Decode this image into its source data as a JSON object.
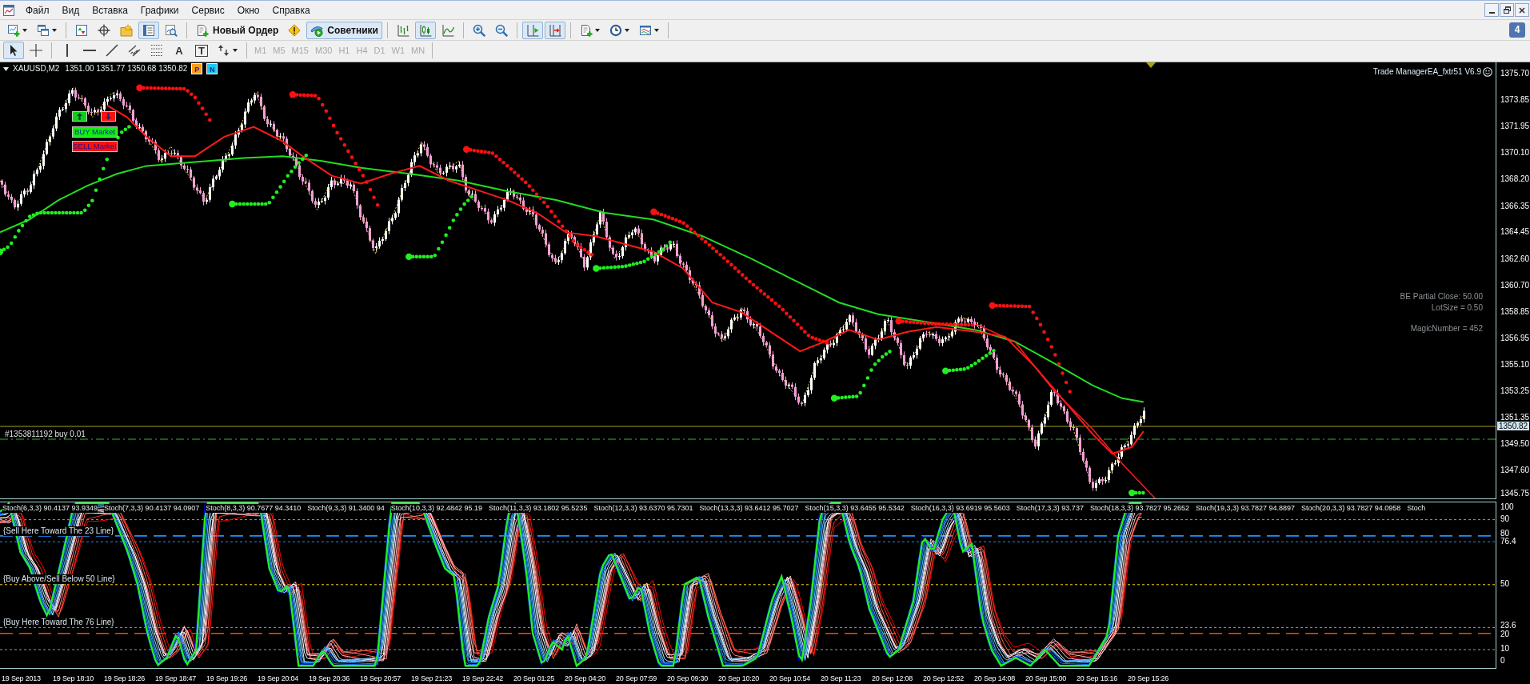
{
  "menu": [
    {
      "label": "Файл"
    },
    {
      "label": "Вид"
    },
    {
      "label": "Вставка"
    },
    {
      "label": "Графики"
    },
    {
      "label": "Сервис"
    },
    {
      "label": "Окно"
    },
    {
      "label": "Справка"
    }
  ],
  "toolbar_1": [
    {
      "kind": "dropdown",
      "pressed": false
    },
    {
      "kind": "dropdown",
      "pressed": false
    },
    {
      "kind": "separator"
    },
    {
      "kind": "icon",
      "pressed": false
    },
    {
      "kind": "icon",
      "pressed": false
    },
    {
      "kind": "icon",
      "pressed": false
    },
    {
      "kind": "icon",
      "pressed": true
    },
    {
      "kind": "icon",
      "pressed": false
    },
    {
      "kind": "separator"
    },
    {
      "kind": "labeled",
      "label": "Новый Ордер",
      "pressed": false
    },
    {
      "kind": "icon",
      "pressed": false
    },
    {
      "kind": "labeled",
      "label": "Советники",
      "pressed": true
    },
    {
      "kind": "separator"
    },
    {
      "kind": "icon",
      "pressed": false
    },
    {
      "kind": "icon",
      "pressed": true
    },
    {
      "kind": "icon",
      "pressed": false
    },
    {
      "kind": "separator"
    },
    {
      "kind": "icon",
      "pressed": false
    },
    {
      "kind": "icon",
      "pressed": false
    },
    {
      "kind": "separator"
    },
    {
      "kind": "icon",
      "pressed": true
    },
    {
      "kind": "icon",
      "pressed": true
    },
    {
      "kind": "separator"
    },
    {
      "kind": "dropdown",
      "pressed": false
    },
    {
      "kind": "dropdown",
      "pressed": false
    },
    {
      "kind": "dropdown",
      "pressed": false
    },
    {
      "kind": "separator"
    }
  ],
  "messages_badge": "4",
  "toolbar_2": [
    {
      "kind": "icon",
      "pressed": true
    },
    {
      "kind": "icon",
      "pressed": false
    },
    {
      "kind": "separator"
    },
    {
      "kind": "icon",
      "pressed": false
    },
    {
      "kind": "icon",
      "pressed": false
    },
    {
      "kind": "icon",
      "pressed": false
    },
    {
      "kind": "icon",
      "pressed": false
    },
    {
      "kind": "icon",
      "pressed": false
    },
    {
      "kind": "glyph",
      "glyph": "A",
      "framed": false,
      "pressed": false
    },
    {
      "kind": "glyph",
      "glyph": "T",
      "framed": true,
      "pressed": false
    },
    {
      "kind": "dropdown",
      "pressed": false
    },
    {
      "kind": "separator"
    },
    {
      "kind": "timeframe",
      "label": "M1",
      "disabled": true
    },
    {
      "kind": "timeframe",
      "label": "M5",
      "disabled": true
    },
    {
      "kind": "timeframe",
      "label": "M15",
      "disabled": true
    },
    {
      "kind": "timeframe",
      "label": "M30",
      "disabled": true
    },
    {
      "kind": "timeframe",
      "label": "H1",
      "disabled": true
    },
    {
      "kind": "timeframe",
      "label": "H4",
      "disabled": true
    },
    {
      "kind": "timeframe",
      "label": "D1",
      "disabled": true
    },
    {
      "kind": "timeframe",
      "label": "W1",
      "disabled": true
    },
    {
      "kind": "timeframe",
      "label": "MN",
      "disabled": true
    },
    {
      "kind": "separator"
    }
  ],
  "chart": {
    "symbol": "XAUUSD,M2",
    "quote": "1351.00 1351.77 1350.68 1350.82",
    "badges": [
      {
        "label": "P",
        "color": "#ff9c1a"
      },
      {
        "label": "N",
        "color": "#1ec8f0"
      }
    ],
    "ea_title": "Trade ManagerEA_fxtr51 V6.9",
    "market_buttons": [
      {
        "kind": "buy",
        "label": "BUY Market"
      },
      {
        "kind": "sell",
        "label": "SELL Market"
      }
    ],
    "info_groups": [
      [
        "BE Partial Close: 50.00",
        "LotSize = 0.50"
      ],
      [
        "MagicNumber = 452"
      ]
    ],
    "order_label": "#1353811192 buy 0.01",
    "price_axis": [
      "1375.70",
      "1373.85",
      "1371.95",
      "1370.10",
      "1368.20",
      "1366.35",
      "1364.45",
      "1362.60",
      "1360.70",
      "1358.85",
      "1356.95",
      "1355.10",
      "1353.25",
      "1351.35",
      "1349.50",
      "1347.60",
      "1345.75"
    ],
    "current_price": "1350.82"
  },
  "indicator": {
    "legend": [
      "Stoch(6,3,3) 90.4137 93.9349",
      "Stoch(7,3,3) 90.4137 94.0907",
      "Stoch(8,3,3) 90.7677 94.3410",
      "Stoch(9,3,3) 91.3400 94",
      "Stoch(10,3,3) 92.4842 95.19",
      "Stoch(11,3,3) 93.1802 95.5235",
      "Stoch(12,3,3) 93.6370 95.7301",
      "Stoch(13,3,3) 93.6412 95.7027",
      "Stoch(15,3,3) 93.6455 95.5342",
      "Stoch(16,3,3) 93.6919 95.5603",
      "Stoch(17,3,3) 93.737",
      "Stoch(18,3,3) 93.7827 95.2652",
      "Stoch(19,3,3) 93.7827 94.8897",
      "Stoch(20,3,3) 93.7827 94.0958",
      "Stoch"
    ],
    "level_notes": [
      "{Sell Here Toward The 23 Line}",
      "{Buy Above/Sell Below 50 Line}",
      "{Buy Here Toward The 76 Line}"
    ],
    "axis": [
      "100",
      "90",
      "80",
      "76.4",
      "50",
      "23.6",
      "20",
      "10",
      "0"
    ]
  },
  "time_axis": [
    "19 Sep 2013",
    "19 Sep 18:10",
    "19 Sep 18:26",
    "19 Sep 18:47",
    "19 Sep 19:26",
    "19 Sep 20:04",
    "19 Sep 20:36",
    "19 Sep 20:57",
    "19 Sep 21:23",
    "19 Sep 22:42",
    "20 Sep 01:25",
    "20 Sep 04:20",
    "20 Sep 07:59",
    "20 Sep 09:30",
    "20 Sep 10:20",
    "20 Sep 10:54",
    "20 Sep 11:23",
    "20 Sep 12:08",
    "20 Sep 12:52",
    "20 Sep 14:08",
    "20 Sep 15:00",
    "20 Sep 15:16",
    "20 Sep 15:26"
  ]
}
